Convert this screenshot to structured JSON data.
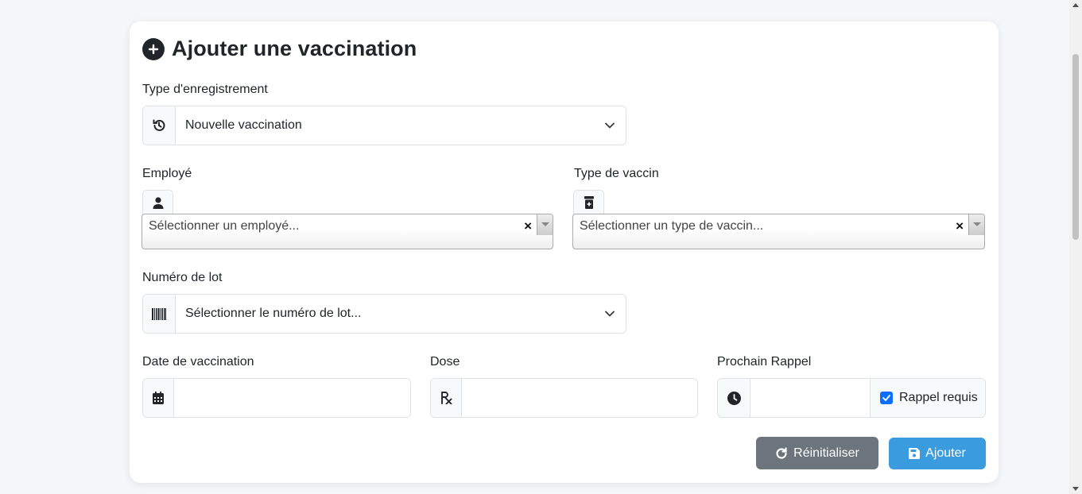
{
  "title": "Ajouter une vaccination",
  "record_type": {
    "label": "Type d'enregistrement",
    "value": "Nouvelle vaccination"
  },
  "employee": {
    "label": "Employé",
    "placeholder": "Sélectionner un employé...",
    "clear": "×"
  },
  "vaccine_type": {
    "label": "Type de vaccin",
    "placeholder": "Sélectionner un type de vaccin...",
    "clear": "×"
  },
  "lot_number": {
    "label": "Numéro de lot",
    "value": "Sélectionner le numéro de lot..."
  },
  "vaccination_date": {
    "label": "Date de vaccination",
    "value": ""
  },
  "dose": {
    "label": "Dose",
    "value": ""
  },
  "next_booster": {
    "label": "Prochain Rappel",
    "value": "",
    "checkbox_label": "Rappel requis",
    "checked": true
  },
  "buttons": {
    "reset": "Réinitialiser",
    "add": "Ajouter"
  },
  "colors": {
    "reset": "#6c757d",
    "add": "#3b9bdf",
    "checkbox": "#0d6efd"
  },
  "icons": {
    "title": "plus-circle-icon",
    "record_type": "history-icon",
    "employee": "user-icon",
    "vaccine": "prescription-bottle-icon",
    "lot": "barcode-icon",
    "date": "calendar-icon",
    "dose": "prescription-icon",
    "booster": "clock-icon",
    "reset": "redo-icon",
    "add": "save-icon"
  }
}
